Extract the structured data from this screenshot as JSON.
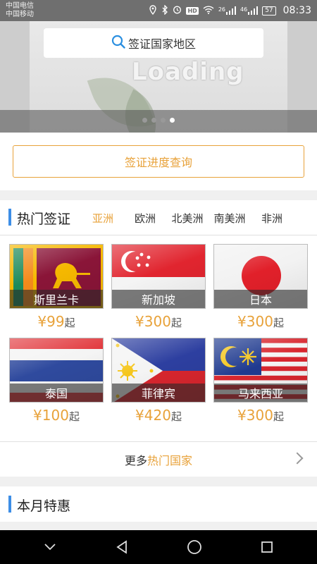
{
  "status_bar": {
    "carrier_1": "中国电信",
    "carrier_2": "中国移动",
    "network_1": "26",
    "network_2": "46",
    "battery": "57",
    "time": "08:33"
  },
  "banner": {
    "loading_text": "Loading",
    "dots": 4,
    "active_dot": 3
  },
  "search": {
    "placeholder": "签证国家地区",
    "icon": "search-icon"
  },
  "query_button": "签证进度查询",
  "hot_visa": {
    "title": "热门签证",
    "tabs": [
      {
        "label": "亚洲",
        "active": true
      },
      {
        "label": "欧洲",
        "active": false
      },
      {
        "label": "北美洲",
        "active": false
      },
      {
        "label": "南美洲",
        "active": false
      },
      {
        "label": "非洲",
        "active": false
      }
    ],
    "countries": [
      {
        "name": "斯里兰卡",
        "price": "¥99",
        "suffix": "起"
      },
      {
        "name": "新加坡",
        "price": "¥300",
        "suffix": "起"
      },
      {
        "name": "日本",
        "price": "¥300",
        "suffix": "起"
      },
      {
        "name": "泰国",
        "price": "¥100",
        "suffix": "起"
      },
      {
        "name": "菲律宾",
        "price": "¥420",
        "suffix": "起"
      },
      {
        "name": "马来西亚",
        "price": "¥300",
        "suffix": "起"
      }
    ],
    "more_prefix": "更多",
    "more_highlight": "热门国家"
  },
  "monthly": {
    "title": "本月特惠"
  },
  "colors": {
    "accent": "#e8a23a",
    "section_bar": "#3d8ee6"
  }
}
